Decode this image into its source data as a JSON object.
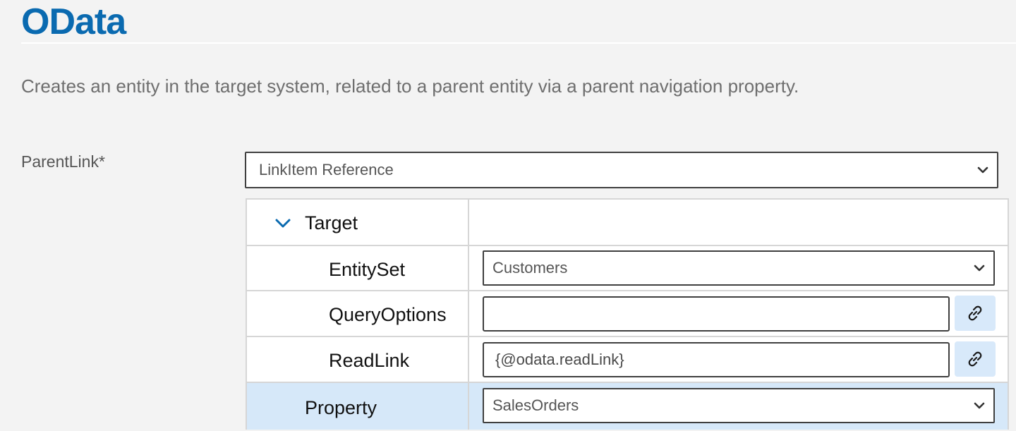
{
  "header": {
    "title": "OData",
    "description": "Creates an entity in the target system, related to a parent entity via a parent navigation property."
  },
  "parent_link": {
    "label": "ParentLink*",
    "selected": "LinkItem Reference"
  },
  "grid": {
    "target": {
      "label": "Target",
      "expanded": true
    },
    "entity_set": {
      "label": "EntitySet",
      "value": "Customers"
    },
    "query_options": {
      "label": "QueryOptions",
      "value": ""
    },
    "read_link": {
      "label": "ReadLink",
      "value": "{@odata.readLink}"
    },
    "property": {
      "label": "Property",
      "value": "SalesOrders"
    }
  },
  "icons": {
    "expander": "chevron-down-icon",
    "dropdown": "chevron-down-icon",
    "link": "link-icon"
  },
  "colors": {
    "title": "#0a6ab0",
    "highlight_row": "#d6e8f9",
    "link_button": "#d8e9fa",
    "background": "#f3f3f3"
  }
}
